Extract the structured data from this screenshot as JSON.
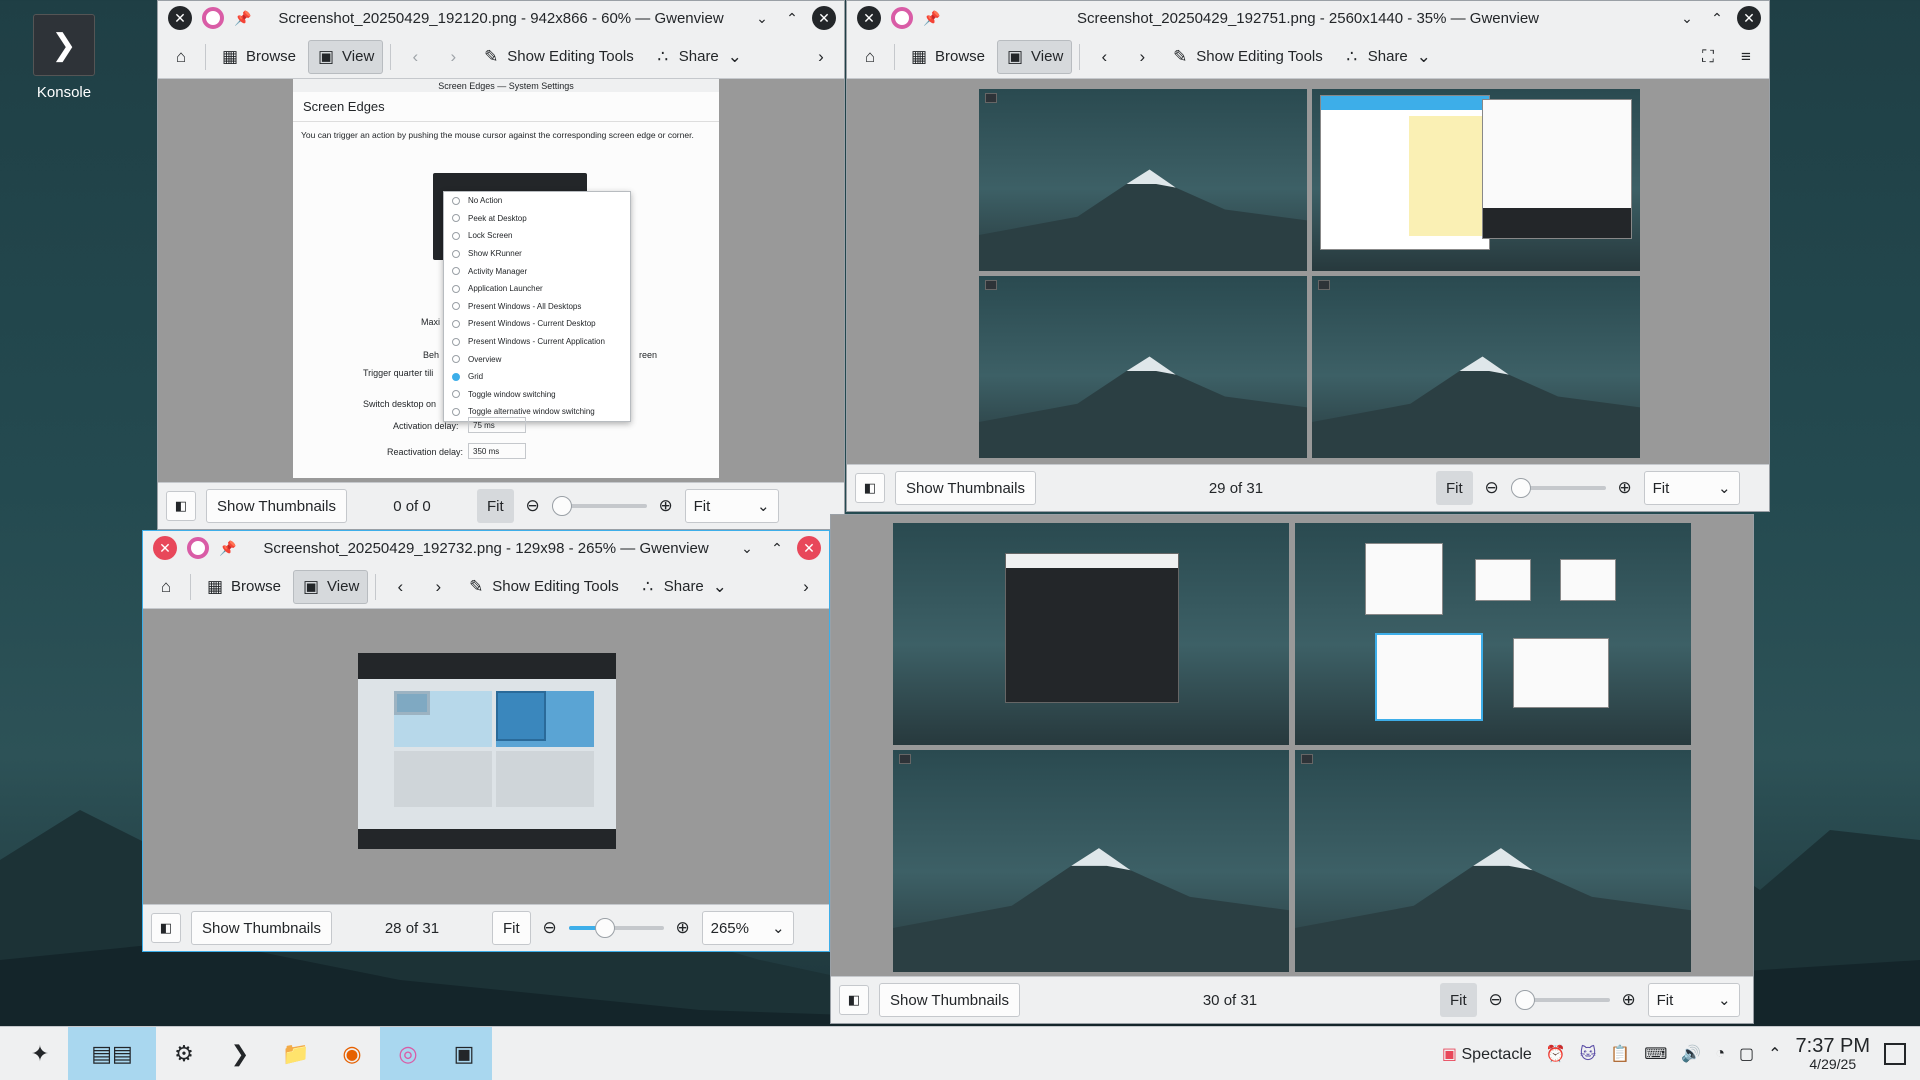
{
  "desktop": {
    "icon_label": "Konsole"
  },
  "toolbar": {
    "browse": "Browse",
    "view": "View",
    "editing": "Show Editing Tools",
    "share": "Share"
  },
  "status": {
    "thumbnails": "Show Thumbnails",
    "fit": "Fit"
  },
  "win1": {
    "title": "Screenshot_20250429_192120.png - 942x866 - 60% — Gwenview",
    "counter": "0 of 0",
    "zoom": "Fit",
    "zoom_level": 0.0
  },
  "win2": {
    "title": "Screenshot_20250429_192751.png - 2560x1440 - 35% — Gwenview",
    "counter": "29 of 31",
    "zoom": "Fit",
    "zoom_level": 0.0
  },
  "win3": {
    "title": "Screenshot_20250429_192732.png - 129x98 - 265% — Gwenview",
    "counter": "28 of 31",
    "zoom": "265%",
    "zoom_level": 0.35
  },
  "win4": {
    "counter": "30 of 31",
    "zoom": "Fit",
    "zoom_level": 0.0
  },
  "settings": {
    "window_title": "Screen Edges — System Settings",
    "heading": "Screen Edges",
    "description": "You can trigger an action by pushing the mouse cursor against the corresponding screen edge or corner.",
    "label_maxi": "Maxi",
    "label_beh": "Beh",
    "label_reen": "reen",
    "label_trigger": "Trigger quarter tili",
    "label_switch": "Switch desktop on",
    "activation_label": "Activation delay:",
    "activation_value": "75 ms",
    "reactivation_label": "Reactivation delay:",
    "reactivation_value": "350 ms",
    "menu_items": [
      "No Action",
      "Peek at Desktop",
      "Lock Screen",
      "Show KRunner",
      "Activity Manager",
      "Application Launcher",
      "Present Windows - All Desktops",
      "Present Windows - Current Desktop",
      "Present Windows - Current Application",
      "Overview",
      "Grid",
      "Toggle window switching",
      "Toggle alternative window switching"
    ],
    "menu_selected": "Grid"
  },
  "taskbar": {
    "spectacle": "Spectacle",
    "time": "7:37 PM",
    "date": "4/29/25"
  },
  "colors": {
    "accent": "#3daee9",
    "close_red": "#e8475a",
    "gwenview_pink": "#d95ca6"
  }
}
